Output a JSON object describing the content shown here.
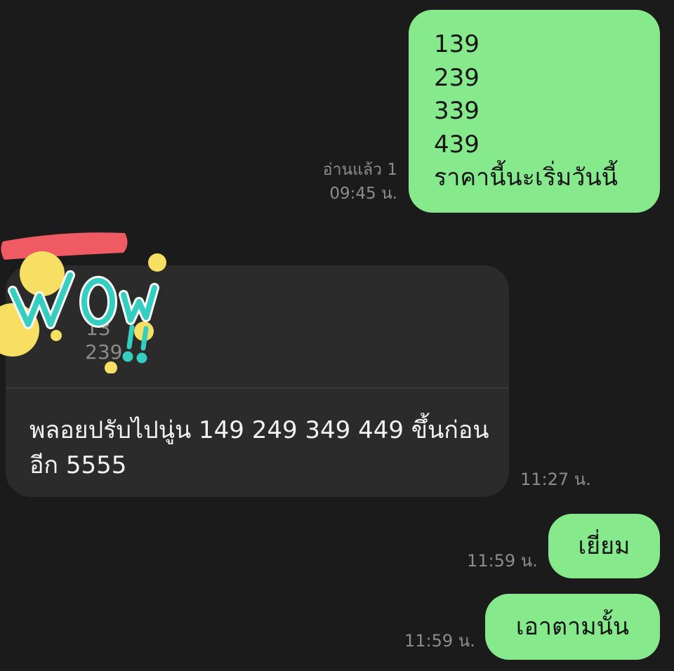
{
  "messages": [
    {
      "direction": "outgoing",
      "lines": [
        "139",
        "239",
        "339",
        "439",
        "ราคานี้นะเริ่มวันนี้"
      ],
      "read_status": "อ่านแล้ว 1",
      "time": "09:45 น."
    },
    {
      "direction": "incoming",
      "quoted_lines": [
        "13",
        "239"
      ],
      "text": "พลอยปรับไปนู่น 149 249 349 449 ขึ้นก่อนอีก 5555",
      "time": "11:27 น."
    },
    {
      "direction": "outgoing",
      "text": "เยี่ยม",
      "time": "11:59 น."
    },
    {
      "direction": "outgoing",
      "text": "เอาตามนั้น",
      "time": "11:59 น."
    }
  ],
  "sticker": {
    "text": "WOW!!",
    "colors": {
      "letters": "#35cfc2",
      "outline": "#ffffff",
      "dots": "#f7df63",
      "band": "#f05a63"
    }
  },
  "colors": {
    "background": "#1b1b1b",
    "outgoing_bubble": "#86e98b",
    "incoming_bubble": "#2b2b2b",
    "meta_text": "#8c8c8c"
  }
}
